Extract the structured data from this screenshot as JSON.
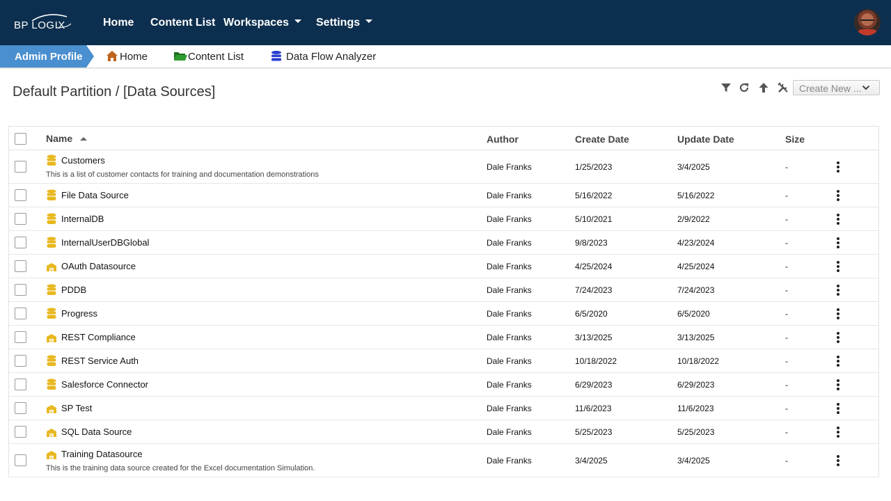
{
  "brand": {
    "logo_text": "BP LOGIX"
  },
  "nav": {
    "home": "Home",
    "content_list": "Content List",
    "workspaces": "Workspaces",
    "settings": "Settings"
  },
  "subnav": {
    "admin_profile": "Admin Profile",
    "home": "Home",
    "content_list": "Content List",
    "data_flow_analyzer": "Data Flow Analyzer"
  },
  "page": {
    "title": "Default Partition / [Data Sources]",
    "create_new": "Create New ..."
  },
  "table": {
    "columns": {
      "name": "Name",
      "author": "Author",
      "create_date": "Create Date",
      "update_date": "Update Date",
      "size": "Size"
    },
    "rows": [
      {
        "name": "Customers",
        "description": "This is a list of customer contacts for training and documentation demonstrations",
        "icon": "database-icon",
        "author": "Dale Franks",
        "create_date": "1/25/2023",
        "update_date": "3/4/2025",
        "size": "-"
      },
      {
        "name": "File Data Source",
        "description": "",
        "icon": "database-icon",
        "author": "Dale Franks",
        "create_date": "5/16/2022",
        "update_date": "5/16/2022",
        "size": "-"
      },
      {
        "name": "InternalDB",
        "description": "",
        "icon": "database-icon",
        "author": "Dale Franks",
        "create_date": "5/10/2021",
        "update_date": "2/9/2022",
        "size": "-"
      },
      {
        "name": "InternalUserDBGlobal",
        "description": "",
        "icon": "database-icon",
        "author": "Dale Franks",
        "create_date": "9/8/2023",
        "update_date": "4/23/2024",
        "size": "-"
      },
      {
        "name": "OAuth Datasource",
        "description": "",
        "icon": "warehouse-icon",
        "author": "Dale Franks",
        "create_date": "4/25/2024",
        "update_date": "4/25/2024",
        "size": "-"
      },
      {
        "name": "PDDB",
        "description": "",
        "icon": "database-icon",
        "author": "Dale Franks",
        "create_date": "7/24/2023",
        "update_date": "7/24/2023",
        "size": "-"
      },
      {
        "name": "Progress",
        "description": "",
        "icon": "database-icon",
        "author": "Dale Franks",
        "create_date": "6/5/2020",
        "update_date": "6/5/2020",
        "size": "-"
      },
      {
        "name": "REST Compliance",
        "description": "",
        "icon": "warehouse-icon",
        "author": "Dale Franks",
        "create_date": "3/13/2025",
        "update_date": "3/13/2025",
        "size": "-"
      },
      {
        "name": "REST Service Auth",
        "description": "",
        "icon": "database-icon",
        "author": "Dale Franks",
        "create_date": "10/18/2022",
        "update_date": "10/18/2022",
        "size": "-"
      },
      {
        "name": "Salesforce Connector",
        "description": "",
        "icon": "database-icon",
        "author": "Dale Franks",
        "create_date": "6/29/2023",
        "update_date": "6/29/2023",
        "size": "-"
      },
      {
        "name": "SP Test",
        "description": "",
        "icon": "warehouse-icon",
        "author": "Dale Franks",
        "create_date": "11/6/2023",
        "update_date": "11/6/2023",
        "size": "-"
      },
      {
        "name": "SQL Data Source",
        "description": "",
        "icon": "warehouse-icon",
        "author": "Dale Franks",
        "create_date": "5/25/2023",
        "update_date": "5/25/2023",
        "size": "-"
      },
      {
        "name": "Training Datasource",
        "description": "This is the training data source created for the Excel documentation Simulation.",
        "icon": "warehouse-icon",
        "author": "Dale Franks",
        "create_date": "3/4/2025",
        "update_date": "3/4/2025",
        "size": "-"
      }
    ]
  },
  "colors": {
    "header_bg": "#0d2f4f",
    "admin_tab": "#4a8fcf",
    "item_icon": "#e8b820",
    "home_icon": "#c0641e",
    "folder_icon": "#2e8b2e",
    "dfa_icon": "#2a3fd0"
  }
}
